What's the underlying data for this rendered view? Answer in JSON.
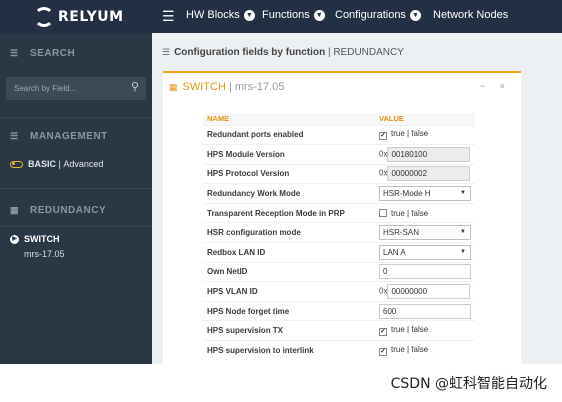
{
  "brand": {
    "name": "RELYUM"
  },
  "topnav": {
    "items": [
      {
        "label": "HW Blocks"
      },
      {
        "label": "Functions"
      },
      {
        "label": "Configurations"
      },
      {
        "label": "Network Nodes"
      }
    ]
  },
  "sidebar": {
    "search_heading": "SEARCH",
    "search_placeholder": "Search by Field...",
    "management_heading": "MANAGEMENT",
    "mode_basic": "BASIC",
    "mode_sep": " | ",
    "mode_advanced": "Advanced",
    "redundancy_heading": "REDUNDANCY",
    "switch_label": "SWITCH",
    "switch_sub": "mrs-17.05"
  },
  "main": {
    "title_main": "Configuration fields by function",
    "title_sep": " | ",
    "title_func": "REDUNDANCY",
    "card": {
      "title": "SWITCH",
      "title_sep": " | ",
      "device": "mrs-17.05",
      "tools": "− ×",
      "headers": {
        "name": "NAME",
        "value": "VALUE"
      },
      "rows": [
        {
          "name": "Redundant ports enabled",
          "kind": "check",
          "checked": true,
          "text": "true | false"
        },
        {
          "name": "HPS Module Version",
          "kind": "hex",
          "prefix": "0x",
          "value": "00180100",
          "readonly": true
        },
        {
          "name": "HPS Protocol Version",
          "kind": "hex",
          "prefix": "0x",
          "value": "00000002",
          "readonly": true
        },
        {
          "name": "Redundancy Work Mode",
          "kind": "select",
          "value": "HSR-Mode H"
        },
        {
          "name": "Transparent Reception Mode in PRP",
          "kind": "check",
          "checked": false,
          "text": "true | false"
        },
        {
          "name": "HSR configuration mode",
          "kind": "select",
          "value": "HSR-SAN"
        },
        {
          "name": "Redbox LAN ID",
          "kind": "select",
          "value": "LAN A"
        },
        {
          "name": "Own NetID",
          "kind": "text",
          "value": "0"
        },
        {
          "name": "HPS VLAN ID",
          "kind": "hex",
          "prefix": "0x",
          "value": "00000000",
          "readonly": false
        },
        {
          "name": "HPS Node forget time",
          "kind": "text",
          "value": "600"
        },
        {
          "name": "HPS supervision TX",
          "kind": "check",
          "checked": true,
          "text": "true | false"
        },
        {
          "name": "HPS supervision to interlink",
          "kind": "check",
          "checked": true,
          "text": "true | false"
        }
      ]
    }
  },
  "watermark": "CSDN @虹科智能自动化"
}
